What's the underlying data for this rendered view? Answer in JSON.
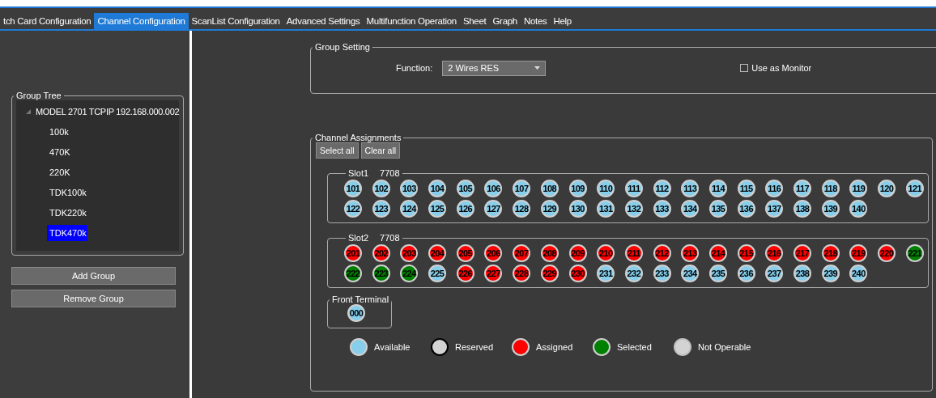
{
  "menu": [
    {
      "label": "tch Card Configuration",
      "selected": false
    },
    {
      "label": "Channel Configuration",
      "selected": true
    },
    {
      "label": "ScanList Configuration",
      "selected": false
    },
    {
      "label": "Advanced Settings",
      "selected": false
    },
    {
      "label": "Multifunction Operation",
      "selected": false
    },
    {
      "label": "Sheet",
      "selected": false
    },
    {
      "label": "Graph",
      "selected": false
    },
    {
      "label": "Notes",
      "selected": false
    },
    {
      "label": "Help",
      "selected": false
    }
  ],
  "group_tree": {
    "title": "Group Tree",
    "root": {
      "label": "MODEL 2701 TCPIP 192.168.000.002",
      "expanded": true,
      "children": [
        {
          "label": "100k",
          "selected": false
        },
        {
          "label": "470K",
          "selected": false
        },
        {
          "label": "220K",
          "selected": false
        },
        {
          "label": "TDK100k",
          "selected": false
        },
        {
          "label": "TDK220k",
          "selected": false
        },
        {
          "label": "TDK470k",
          "selected": true
        }
      ]
    }
  },
  "left_buttons": [
    "Add Group",
    "Remove Group"
  ],
  "group_setting": {
    "title": "Group Setting",
    "function_label": "Function:",
    "function_value": "2 Wires RES",
    "monitor_label": "Use as Monitor",
    "monitor_checked": false
  },
  "channel_assignments": {
    "title": "Channel Assignments",
    "buttons": [
      "Select all",
      "Clear all"
    ],
    "slots": [
      {
        "name": "Slot1",
        "card": "7708",
        "channels": [
          {
            "label": "101",
            "kind": "available"
          },
          {
            "label": "102",
            "kind": "available"
          },
          {
            "label": "103",
            "kind": "available"
          },
          {
            "label": "104",
            "kind": "available"
          },
          {
            "label": "105",
            "kind": "available"
          },
          {
            "label": "106",
            "kind": "available"
          },
          {
            "label": "107",
            "kind": "available"
          },
          {
            "label": "108",
            "kind": "available"
          },
          {
            "label": "109",
            "kind": "available"
          },
          {
            "label": "110",
            "kind": "available"
          },
          {
            "label": "111",
            "kind": "available"
          },
          {
            "label": "112",
            "kind": "available"
          },
          {
            "label": "113",
            "kind": "available"
          },
          {
            "label": "114",
            "kind": "available"
          },
          {
            "label": "115",
            "kind": "available"
          },
          {
            "label": "116",
            "kind": "available"
          },
          {
            "label": "117",
            "kind": "available"
          },
          {
            "label": "118",
            "kind": "available"
          },
          {
            "label": "119",
            "kind": "available"
          },
          {
            "label": "120",
            "kind": "available"
          },
          {
            "label": "121",
            "kind": "available"
          },
          {
            "label": "122",
            "kind": "available"
          },
          {
            "label": "123",
            "kind": "available"
          },
          {
            "label": "124",
            "kind": "available"
          },
          {
            "label": "125",
            "kind": "available"
          },
          {
            "label": "126",
            "kind": "available"
          },
          {
            "label": "127",
            "kind": "available"
          },
          {
            "label": "128",
            "kind": "available"
          },
          {
            "label": "129",
            "kind": "available"
          },
          {
            "label": "130",
            "kind": "available"
          },
          {
            "label": "131",
            "kind": "available"
          },
          {
            "label": "132",
            "kind": "available"
          },
          {
            "label": "133",
            "kind": "available"
          },
          {
            "label": "134",
            "kind": "available"
          },
          {
            "label": "135",
            "kind": "available"
          },
          {
            "label": "136",
            "kind": "available"
          },
          {
            "label": "137",
            "kind": "available"
          },
          {
            "label": "138",
            "kind": "available"
          },
          {
            "label": "139",
            "kind": "available"
          },
          {
            "label": "140",
            "kind": "available"
          }
        ]
      },
      {
        "name": "Slot2",
        "card": "7708",
        "channels": [
          {
            "label": "201",
            "kind": "assigned"
          },
          {
            "label": "202",
            "kind": "assigned"
          },
          {
            "label": "203",
            "kind": "assigned"
          },
          {
            "label": "204",
            "kind": "assigned"
          },
          {
            "label": "205",
            "kind": "assigned"
          },
          {
            "label": "206",
            "kind": "assigned"
          },
          {
            "label": "207",
            "kind": "assigned"
          },
          {
            "label": "208",
            "kind": "assigned"
          },
          {
            "label": "209",
            "kind": "assigned"
          },
          {
            "label": "210",
            "kind": "assigned"
          },
          {
            "label": "211",
            "kind": "assigned"
          },
          {
            "label": "212",
            "kind": "assigned"
          },
          {
            "label": "213",
            "kind": "assigned"
          },
          {
            "label": "214",
            "kind": "assigned"
          },
          {
            "label": "215",
            "kind": "assigned"
          },
          {
            "label": "216",
            "kind": "assigned"
          },
          {
            "label": "217",
            "kind": "assigned"
          },
          {
            "label": "218",
            "kind": "assigned"
          },
          {
            "label": "219",
            "kind": "assigned"
          },
          {
            "label": "220",
            "kind": "assigned"
          },
          {
            "label": "221",
            "kind": "selected"
          },
          {
            "label": "222",
            "kind": "selected"
          },
          {
            "label": "223",
            "kind": "selected"
          },
          {
            "label": "224",
            "kind": "selected"
          },
          {
            "label": "225",
            "kind": "available"
          },
          {
            "label": "226",
            "kind": "assigned"
          },
          {
            "label": "227",
            "kind": "assigned"
          },
          {
            "label": "228",
            "kind": "assigned"
          },
          {
            "label": "229",
            "kind": "assigned"
          },
          {
            "label": "230",
            "kind": "assigned"
          },
          {
            "label": "231",
            "kind": "available"
          },
          {
            "label": "232",
            "kind": "available"
          },
          {
            "label": "233",
            "kind": "available"
          },
          {
            "label": "234",
            "kind": "available"
          },
          {
            "label": "235",
            "kind": "available"
          },
          {
            "label": "236",
            "kind": "available"
          },
          {
            "label": "237",
            "kind": "available"
          },
          {
            "label": "238",
            "kind": "available"
          },
          {
            "label": "239",
            "kind": "available"
          },
          {
            "label": "240",
            "kind": "available"
          }
        ]
      }
    ],
    "front_terminal": {
      "title": "Front Terminal",
      "channel": {
        "label": "000",
        "kind": "available"
      }
    },
    "legend": [
      {
        "label": "Available",
        "kind": "available"
      },
      {
        "label": "Reserved",
        "kind": "reserved"
      },
      {
        "label": "Assigned",
        "kind": "assigned"
      },
      {
        "label": "Selected",
        "kind": "selected"
      },
      {
        "label": "Not Operable",
        "kind": "not_operable"
      }
    ]
  }
}
